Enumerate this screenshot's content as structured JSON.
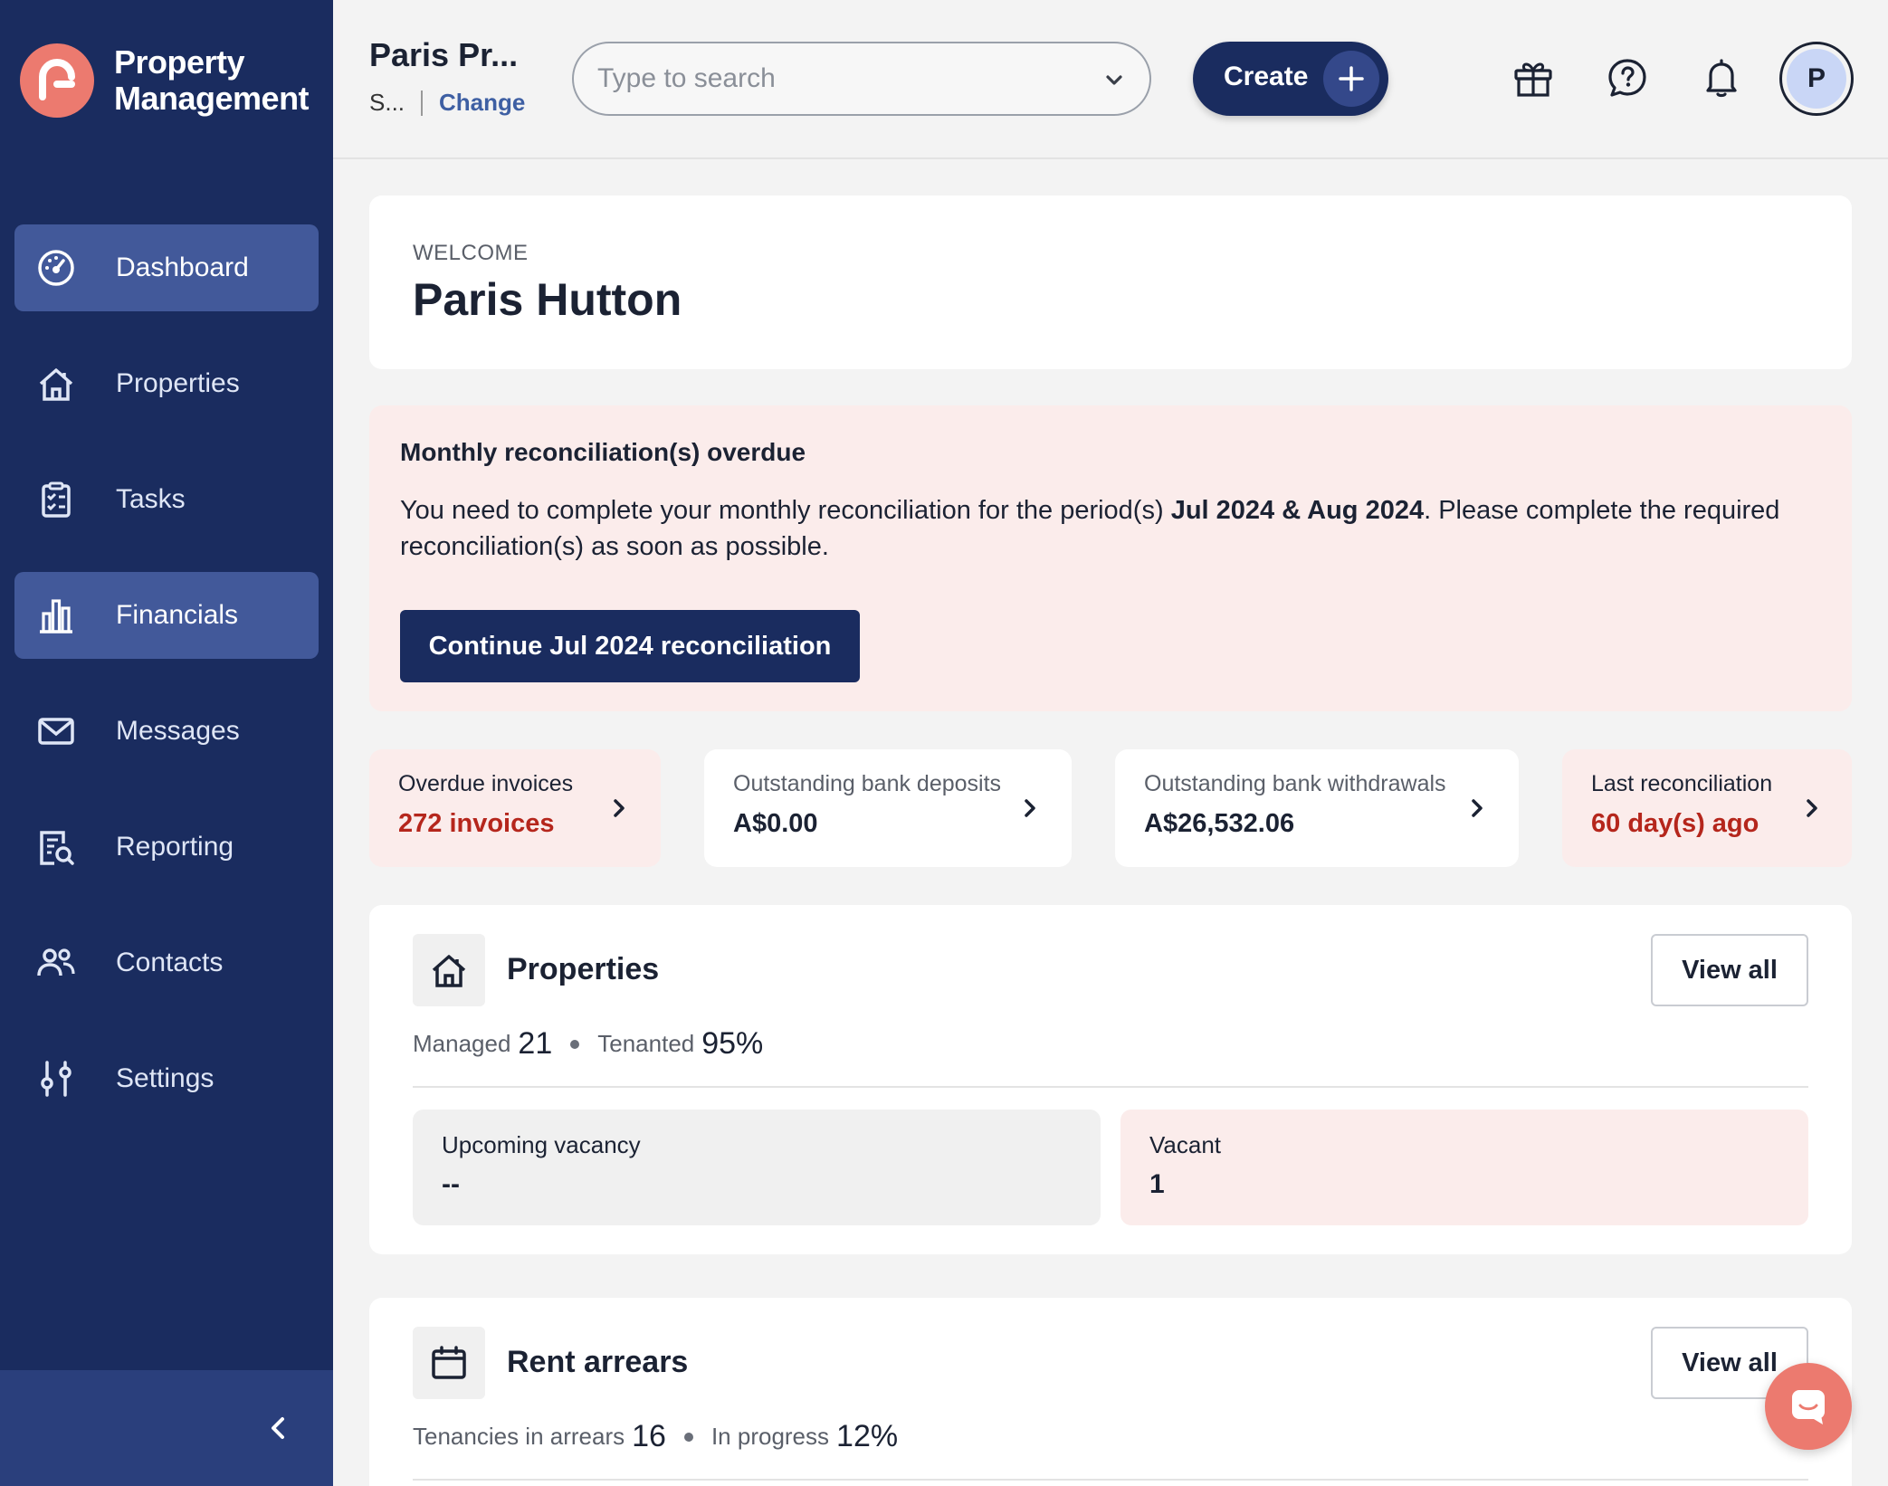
{
  "brand": {
    "line1": "Property",
    "line2": "Management",
    "accent": "#ec7a6f"
  },
  "sidebar": {
    "items": [
      {
        "label": "Dashboard",
        "icon": "dashboard-gauge-icon",
        "active": true
      },
      {
        "label": "Properties",
        "icon": "house-icon",
        "active": false
      },
      {
        "label": "Tasks",
        "icon": "clipboard-list-icon",
        "active": false
      },
      {
        "label": "Financials",
        "icon": "bar-chart-icon",
        "active": true
      },
      {
        "label": "Messages",
        "icon": "envelope-icon",
        "active": false
      },
      {
        "label": "Reporting",
        "icon": "report-search-icon",
        "active": false
      },
      {
        "label": "Contacts",
        "icon": "users-icon",
        "active": false
      },
      {
        "label": "Settings",
        "icon": "sliders-icon",
        "active": false
      }
    ],
    "collapse_icon": "chevron-left-icon"
  },
  "header": {
    "account_name": "Paris Pr...",
    "account_sub": "S...",
    "change_label": "Change",
    "search_placeholder": "Type to search",
    "create_label": "Create",
    "avatar_initial": "P"
  },
  "welcome": {
    "kicker": "WELCOME",
    "name": "Paris Hutton"
  },
  "alert": {
    "title": "Monthly reconciliation(s) overdue",
    "body_pre": "You need to complete your monthly reconciliation for the period(s) ",
    "body_bold": "Jul 2024 & Aug 2024",
    "body_post": ". Please complete the required reconciliation(s) as soon as possible.",
    "button_label": "Continue Jul 2024 reconciliation"
  },
  "stats": [
    {
      "label": "Overdue invoices",
      "value": "272 invoices",
      "warn": true
    },
    {
      "label": "Outstanding bank deposits",
      "value": "A$0.00",
      "warn": false
    },
    {
      "label": "Outstanding bank withdrawals",
      "value": "A$26,532.06",
      "warn": false
    },
    {
      "label": "Last reconciliation",
      "value": "60 day(s) ago",
      "warn": true
    }
  ],
  "properties": {
    "title": "Properties",
    "view_all": "View all",
    "managed_label": "Managed",
    "managed_value": "21",
    "tenanted_label": "Tenanted",
    "tenanted_value": "95%",
    "upcoming_label": "Upcoming vacancy",
    "upcoming_value": "--",
    "vacant_label": "Vacant",
    "vacant_value": "1"
  },
  "arrears": {
    "title": "Rent arrears",
    "view_all": "View all",
    "tenancies_label": "Tenancies in arrears",
    "tenancies_value": "16",
    "progress_label": "In progress",
    "progress_value": "12%"
  },
  "colors": {
    "sidebar": "#1a2c5f",
    "active_nav": "#42599a",
    "warn_bg": "#fbeceb",
    "warn_text": "#b5261c"
  }
}
